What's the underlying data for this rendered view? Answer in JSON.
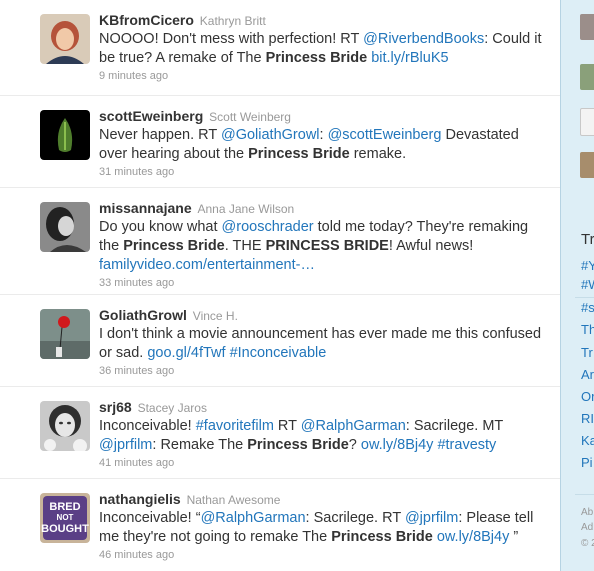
{
  "tweets": [
    {
      "screen_name": "KBfromCicero",
      "real_name": "Kathryn Britt",
      "segments": [
        {
          "t": "NOOOO! Don't mess with perfection! RT "
        },
        {
          "t": "@RiverbendBooks",
          "link": true
        },
        {
          "t": ": Could it be true? A remake of The "
        },
        {
          "t": "Princess Bride",
          "bold": true
        },
        {
          "t": " "
        },
        {
          "t": "bit.ly/rBluK5",
          "link": true
        }
      ],
      "time": "9 minutes ago",
      "avatar": "woman-portrait-avatar"
    },
    {
      "screen_name": "scottEweinberg",
      "real_name": "Scott Weinberg",
      "segments": [
        {
          "t": "Never happen. RT "
        },
        {
          "t": "@GoliathGrowl",
          "link": true
        },
        {
          "t": ": "
        },
        {
          "t": "@scottEweinberg",
          "link": true
        },
        {
          "t": " Devastated over hearing about the "
        },
        {
          "t": "Princess Bride",
          "bold": true
        },
        {
          "t": " remake."
        }
      ],
      "time": "31 minutes ago",
      "avatar": "alien-egg-avatar"
    },
    {
      "screen_name": "missannajane",
      "real_name": "Anna Jane Wilson",
      "segments": [
        {
          "t": "Do you know what "
        },
        {
          "t": "@rooschrader",
          "link": true
        },
        {
          "t": " told me today? They're remaking the "
        },
        {
          "t": "Princess Bride",
          "bold": true
        },
        {
          "t": ". THE "
        },
        {
          "t": "PRINCESS BRIDE",
          "bold": true
        },
        {
          "t": "! Awful news! "
        },
        {
          "t": "familyvideo.com/entertainment-…",
          "link": true
        }
      ],
      "time": "33 minutes ago",
      "avatar": "bw-portrait-avatar"
    },
    {
      "screen_name": "GoliathGrowl",
      "real_name": "Vince H.",
      "segments": [
        {
          "t": "I don't think a movie announcement has ever made me this confused or sad. "
        },
        {
          "t": "goo.gl/4fTwf",
          "link": true
        },
        {
          "t": " "
        },
        {
          "t": "#Inconceivable",
          "link": true
        }
      ],
      "time": "36 minutes ago",
      "avatar": "red-balloon-avatar"
    },
    {
      "screen_name": "srj68",
      "real_name": "Stacey Jaros",
      "segments": [
        {
          "t": "Inconceivable! "
        },
        {
          "t": "#favoritefilm",
          "link": true
        },
        {
          "t": " RT "
        },
        {
          "t": "@RalphGarman",
          "link": true
        },
        {
          "t": ": Sacrilege. MT "
        },
        {
          "t": "@jprfilm",
          "link": true
        },
        {
          "t": ": Remake The "
        },
        {
          "t": "Princess Bride",
          "bold": true
        },
        {
          "t": "? "
        },
        {
          "t": "ow.ly/8Bj4y",
          "link": true
        },
        {
          "t": " "
        },
        {
          "t": "#travesty",
          "link": true
        }
      ],
      "time": "41 minutes ago",
      "avatar": "face-portrait-avatar"
    },
    {
      "screen_name": "nathangielis",
      "real_name": "Nathan Awesome",
      "segments": [
        {
          "t": "Inconceivable! “"
        },
        {
          "t": "@RalphGarman",
          "link": true
        },
        {
          "t": ": Sacrilege. RT "
        },
        {
          "t": "@jprfilm",
          "link": true
        },
        {
          "t": ": Please tell me they're not going to remake The "
        },
        {
          "t": "Princess Bride",
          "bold": true
        },
        {
          "t": " "
        },
        {
          "t": "ow.ly/8Bj4y",
          "link": true
        },
        {
          "t": " ”"
        }
      ],
      "time": "46 minutes ago",
      "avatar": "bred-not-bought-avatar",
      "avatar_text": [
        "BRED",
        "NOT",
        "BOUGHT"
      ]
    }
  ],
  "sidebar": {
    "heading": "Tr",
    "trends": [
      "#Y",
      "#W",
      "#s",
      "Th",
      "Tr",
      "Ar",
      "Or",
      "RI",
      "Ka",
      "Pi"
    ],
    "footer": [
      "Ab",
      "Ad",
      "© 2"
    ]
  },
  "colors": {
    "link": "#2276bb",
    "background": "#c0deed",
    "sidebar": "#ddeef6"
  }
}
